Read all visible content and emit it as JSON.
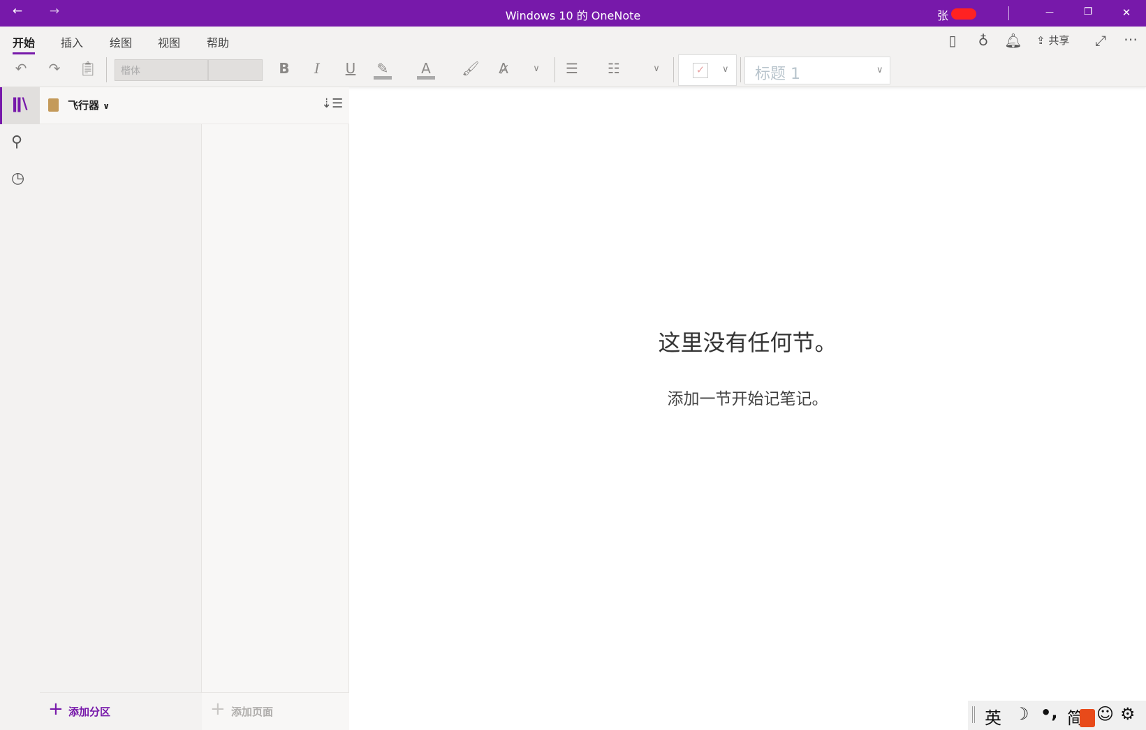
{
  "window": {
    "title": "Windows 10 的 OneNote",
    "user": "张",
    "back": "←",
    "forward": "→",
    "minimize": "—",
    "restore": "❐",
    "close": "✕"
  },
  "ribbon": {
    "tabs": [
      {
        "label": "开始",
        "active": true
      },
      {
        "label": "插入"
      },
      {
        "label": "绘图"
      },
      {
        "label": "视图"
      },
      {
        "label": "帮助"
      }
    ],
    "share_label": "共享",
    "font_name": "楷体",
    "font_size": "",
    "bold": "B",
    "italic": "I",
    "underline": "U",
    "font_color": "A",
    "style": "标题 1"
  },
  "notebook": {
    "name": "飞行器"
  },
  "panes": {
    "add_section": "添加分区",
    "add_page": "添加页面"
  },
  "content": {
    "heading": "这里没有任何节。",
    "subtext": "添加一节开始记笔记。"
  },
  "ime": {
    "mode": "英",
    "simplified": "简",
    "punct": "•,",
    "moon": "☽",
    "emoji": "☺",
    "settings": "⚙"
  },
  "colors": {
    "accent": "#7719aa"
  }
}
